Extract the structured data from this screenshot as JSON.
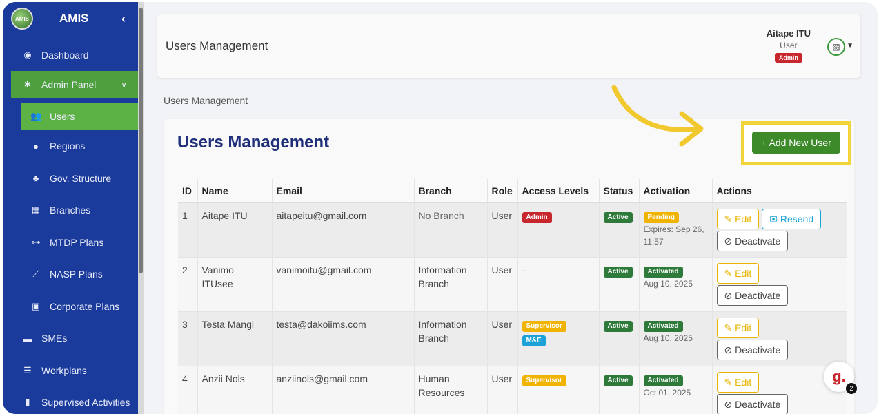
{
  "app": {
    "brand": "AMIS",
    "logo_text": "AMIS"
  },
  "sidebar": {
    "collapse_icon": "chevron-left-icon",
    "items": [
      {
        "label": "Dashboard",
        "icon": "gauge-icon"
      },
      {
        "label": "Admin Panel",
        "icon": "gear-icon"
      },
      {
        "label": "Users",
        "icon": "users-icon"
      },
      {
        "label": "Regions",
        "icon": "map-pin-icon"
      },
      {
        "label": "Gov. Structure",
        "icon": "sitemap-icon"
      },
      {
        "label": "Branches",
        "icon": "building-icon"
      },
      {
        "label": "MTDP Plans",
        "icon": "network-icon"
      },
      {
        "label": "NASP Plans",
        "icon": "chart-line-icon"
      },
      {
        "label": "Corporate Plans",
        "icon": "briefcase-icon"
      },
      {
        "label": "SMEs",
        "icon": "store-icon"
      },
      {
        "label": "Workplans",
        "icon": "list-check-icon"
      },
      {
        "label": "Supervised Activities",
        "icon": "clipboard-icon"
      }
    ]
  },
  "header": {
    "title": "Users Management",
    "user_name": "Aitape ITU",
    "user_role": "User",
    "user_badge": "Admin"
  },
  "breadcrumb": "Users Management",
  "card": {
    "title": "Users Management",
    "add_button": "+ Add New User"
  },
  "table": {
    "headers": [
      "ID",
      "Name",
      "Email",
      "Branch",
      "Role",
      "Access Levels",
      "Status",
      "Activation",
      "Actions"
    ],
    "rows": [
      {
        "id": "1",
        "name": "Aitape ITU",
        "email": "aitapeitu@gmail.com",
        "branch": "No Branch",
        "role": "User",
        "access": [
          "Admin"
        ],
        "status": "Active",
        "activation": "Pending",
        "activation_note": "Expires: Sep 26, 11:57",
        "actions": [
          "Edit",
          "Resend",
          "Deactivate"
        ]
      },
      {
        "id": "2",
        "name": "Vanimo ITUsee",
        "email": "vanimoitu@gmail.com",
        "branch": "Information Branch",
        "role": "User",
        "access_text": "-",
        "status": "Active",
        "activation": "Activated",
        "activation_note": "Aug 10, 2025",
        "actions": [
          "Edit",
          "Deactivate"
        ]
      },
      {
        "id": "3",
        "name": "Testa Mangi",
        "email": "testa@dakoiims.com",
        "branch": "Information Branch",
        "role": "User",
        "access": [
          "Supervisor",
          "M&E"
        ],
        "status": "Active",
        "activation": "Activated",
        "activation_note": "Aug 10, 2025",
        "actions": [
          "Edit",
          "Deactivate"
        ]
      },
      {
        "id": "4",
        "name": "Anzii Nols",
        "email": "anziinols@gmail.com",
        "branch": "Human Resources",
        "role": "User",
        "access": [
          "Supervisor"
        ],
        "status": "Active",
        "activation": "Activated",
        "activation_note": "Oct 01, 2025",
        "actions": [
          "Edit",
          "Deactivate"
        ]
      }
    ]
  },
  "widget": {
    "letter": "g.",
    "count": "2"
  },
  "colors": {
    "sidebar": "#1a3a9c",
    "accent_green": "#4e9f3d",
    "highlight": "#f2d43a",
    "title_blue": "#1f2f7a"
  }
}
